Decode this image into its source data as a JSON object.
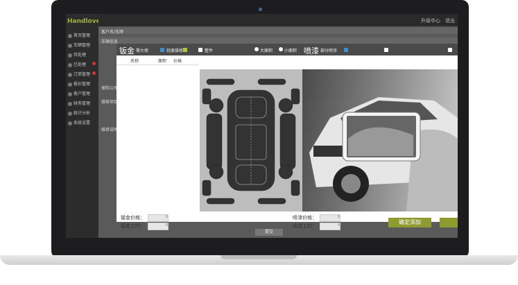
{
  "app": {
    "logo_text": "Handlover",
    "top_right": [
      "升级中心",
      "退出"
    ],
    "sidebar": [
      {
        "label": "首页管理"
      },
      {
        "label": "车辆管理"
      },
      {
        "label": "待处理"
      },
      {
        "label": "已处理"
      },
      {
        "label": "订单管理"
      },
      {
        "label": "报价管理"
      },
      {
        "label": "客户管理"
      },
      {
        "label": "财务管理"
      },
      {
        "label": "统计分析"
      },
      {
        "label": "系统设置"
      }
    ],
    "bg_labels": [
      "客户名/车牌",
      "车辆信息",
      "保险公司",
      "维修项目",
      "维修说明",
      "提交"
    ]
  },
  "modal": {
    "sheet_metal": {
      "title": "钣金",
      "options": [
        "需大修",
        "轻度维修",
        "整件"
      ],
      "columns": [
        "名称",
        "面积",
        "价格"
      ],
      "footer": [
        {
          "label": "钣金价格：",
          "value": "0"
        },
        {
          "label": "钣金工时：",
          "value": "0"
        }
      ]
    },
    "paint": {
      "title": "喷漆",
      "options": [
        "大面积",
        "小面积",
        "部分喷涂"
      ],
      "footer": [
        {
          "label": "喷漆价格：",
          "value": "0"
        },
        {
          "label": "喷漆工时：",
          "value": "0"
        }
      ]
    },
    "confirm_button": "确定添加",
    "colors": {
      "accent": "#8e9b2e",
      "blue": "#3a8fd6",
      "header": "#4a4a4a"
    }
  }
}
